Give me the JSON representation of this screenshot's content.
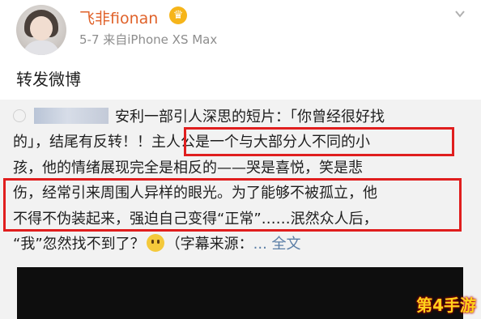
{
  "post": {
    "username": "飞非fionan",
    "meta": "5-7  来自iPhone XS Max",
    "text": "转发微博"
  },
  "icons": {
    "crown": "crown-icon",
    "chevron": "chevron-down-icon",
    "emoji": "smile-emoji-icon"
  },
  "repost": {
    "lines": [
      "安利一部引人深思的短片：「你曾经很好找",
      "的」，结尾有反转！！主人公是一个与大部分人不同的小",
      "孩，他的情绪展现完全是相反的——哭是喜悦，笑是悲",
      "伤，经常引来周围人异样的眼光。为了能够不被孤立，他",
      "不得不伪装起来，强迫自己变得“正常”……泯然众人后，",
      "“我”忽然找不到了？",
      "（字幕来源：",
      "... 全文"
    ]
  },
  "watermark": "第4手游",
  "colors": {
    "username": "#e0622a",
    "highlight": "#e01e1e",
    "link": "#5b7ea6"
  }
}
